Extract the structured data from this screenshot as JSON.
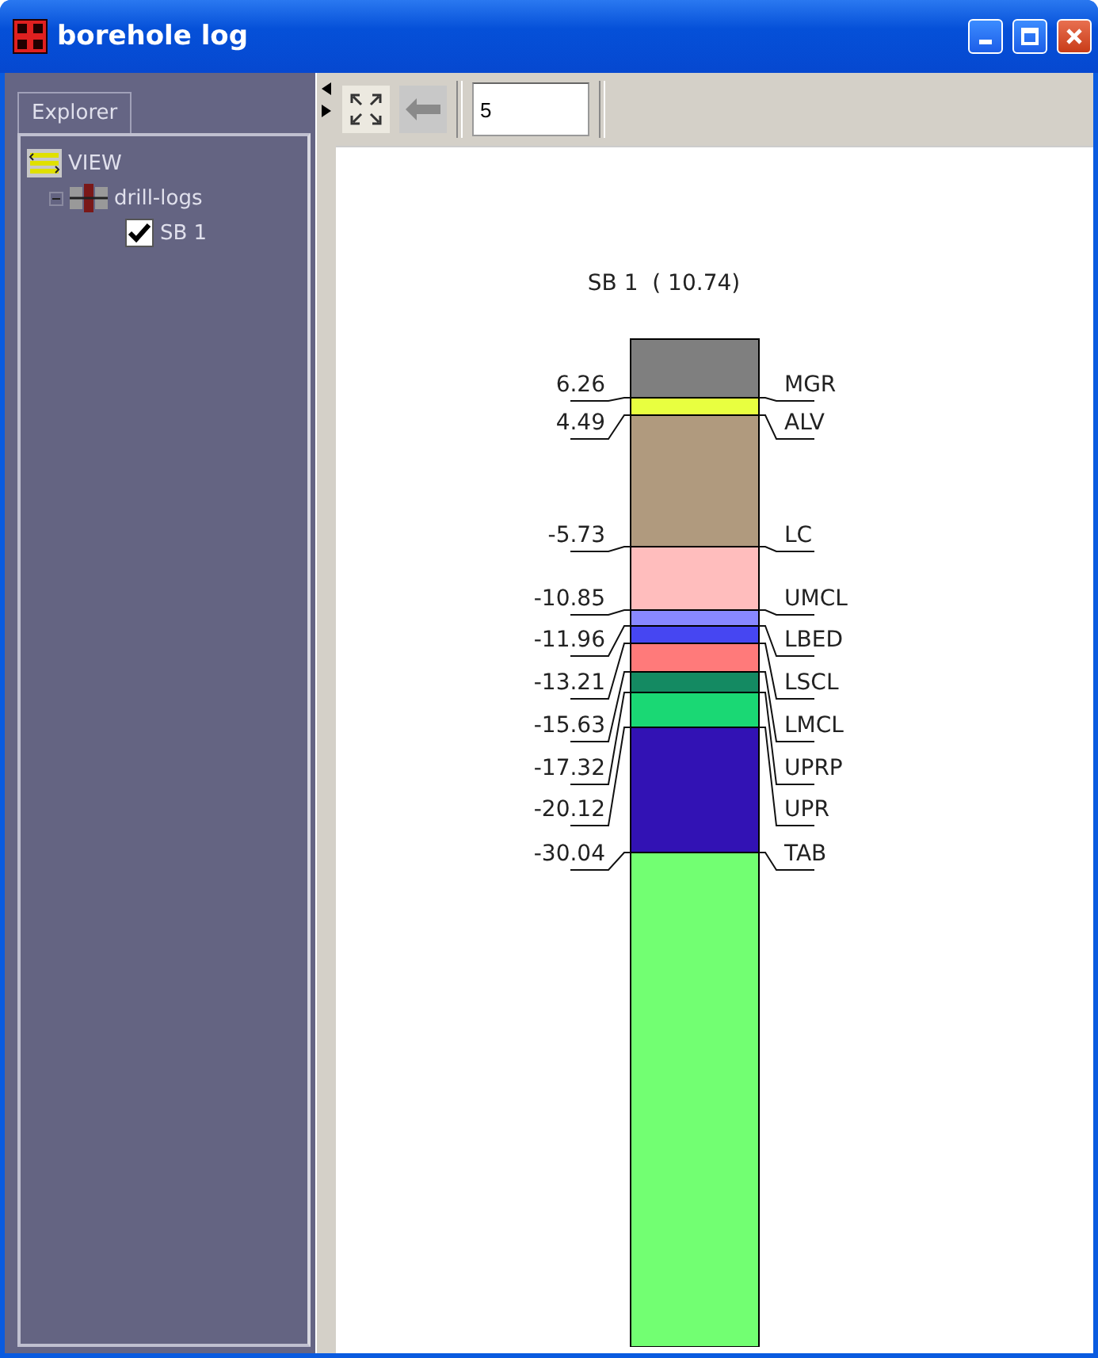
{
  "window": {
    "title": "borehole log"
  },
  "explorer": {
    "tab": {
      "label": "Explorer",
      "selected": true
    },
    "tree": [
      {
        "label": "VIEW",
        "children": [
          {
            "label": "drill-logs",
            "expanded": true,
            "children": [
              {
                "label": "SB 1",
                "checked": true
              }
            ]
          }
        ]
      }
    ]
  },
  "toolbar": {
    "back_disabled": true,
    "field_value": "5"
  },
  "log": {
    "title": "SB 1  ( 10.74)",
    "layers": [
      {
        "color": "#7f7f7f"
      },
      {
        "color": "#e8ff40"
      },
      {
        "color": "#b09a7e"
      },
      {
        "color": "#ffbdbd"
      },
      {
        "color": "#8888ff"
      },
      {
        "color": "#4646f2"
      },
      {
        "color": "#ff7a7a"
      },
      {
        "color": "#148a62"
      },
      {
        "color": "#1ad874"
      },
      {
        "color": "#3212b4"
      },
      {
        "color": "#72ff72"
      }
    ],
    "boundaries": [
      {
        "depth": "6.26",
        "name": "MGR"
      },
      {
        "depth": "4.49",
        "name": "ALV"
      },
      {
        "depth": "-5.73",
        "name": "LC"
      },
      {
        "depth": "-10.85",
        "name": "UMCL"
      },
      {
        "depth": "-11.96",
        "name": "LBED"
      },
      {
        "depth": "-13.21",
        "name": "LSCL"
      },
      {
        "depth": "-15.63",
        "name": "LMCL"
      },
      {
        "depth": "-17.32",
        "name": "UPRP"
      },
      {
        "depth": "-20.12",
        "name": "UPR"
      },
      {
        "depth": "-30.04",
        "name": "TAB"
      }
    ]
  }
}
